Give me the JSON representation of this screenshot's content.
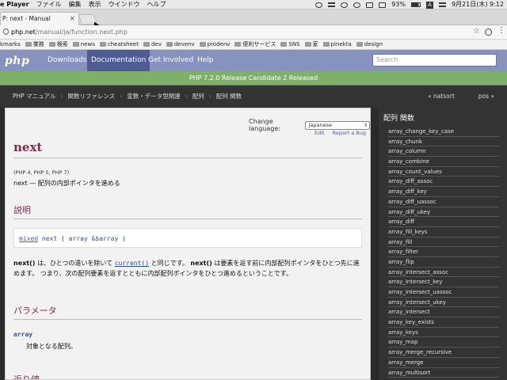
{
  "menubar": {
    "app_name": "e Player",
    "items": [
      "ファイル",
      "編集",
      "表示",
      "ウインドウ",
      "ヘルプ"
    ],
    "battery": "93%",
    "input_method": "A",
    "datetime": "9月21日(木) 9:12"
  },
  "browser": {
    "tab_title": "P: next - Manual",
    "url_host": "php.net",
    "url_path": "/manual/ja/function.next.php",
    "bookmarks": [
      "kmarks",
      "業務",
      "検索",
      "news",
      "cheatsheet",
      "dev",
      "devenv",
      "prodenv",
      "便利サービス",
      "SNS",
      "家",
      "pinekta",
      "design"
    ]
  },
  "php_header": {
    "logo": "php",
    "nav": [
      "Downloads",
      "Documentation",
      "Get Involved",
      "Help"
    ],
    "search_placeholder": "Search",
    "banner": "PHP 7.2.0 Release Candidate 2 Released"
  },
  "breadcrumb": {
    "items": [
      "PHP マニュアル",
      "関数リファレンス",
      "変数・データ型関連",
      "配列",
      "配列 関数"
    ],
    "prev": "« natsort",
    "next": "pos »"
  },
  "content": {
    "change_language_label": "Change language:",
    "language_value": "Japanese",
    "edit_link": "Edit",
    "report_link": "Report a Bug",
    "function_name": "next",
    "versions": "(PHP 4, PHP 5, PHP 7)",
    "purpose": "next — 配列の内部ポインタを進める",
    "heading_description": "説明",
    "synopsis": {
      "return_type": "mixed",
      "function": "next",
      "open_paren": "(",
      "param_type": "array",
      "param": "&$array",
      "close_paren": ")"
    },
    "desc_line1_a": "next()",
    "desc_line1_b": " は、ひとつの違いを除いて ",
    "desc_line1_link": "current()",
    "desc_line1_c": " と同じです。 ",
    "desc_line1_d": "next()",
    "desc_line1_e": " は要素を返す前に内部配列ポインタをひとつ先に進",
    "desc_line2": "めます。 つまり、次の配列要素を返すとともに内部配列ポインタをひとつ進めるということです。",
    "heading_parameters": "パラメータ",
    "param_name": "array",
    "param_desc": "対象となる配列。",
    "heading_return_partial": "返り値"
  },
  "sidebar": {
    "title": "配列 関数",
    "items": [
      "array_change_key_case",
      "array_chunk",
      "array_column",
      "array_combine",
      "array_count_values",
      "array_diff_assoc",
      "array_diff_key",
      "array_diff_uassoc",
      "array_diff_ukey",
      "array_diff",
      "array_fill_keys",
      "array_fill",
      "array_filter",
      "array_flip",
      "array_intersect_assoc",
      "array_intersect_key",
      "array_intersect_uassoc",
      "array_intersect_ukey",
      "array_intersect",
      "array_key_exists",
      "array_keys",
      "array_map",
      "array_merge_recursive",
      "array_merge",
      "array_multisort"
    ]
  }
}
